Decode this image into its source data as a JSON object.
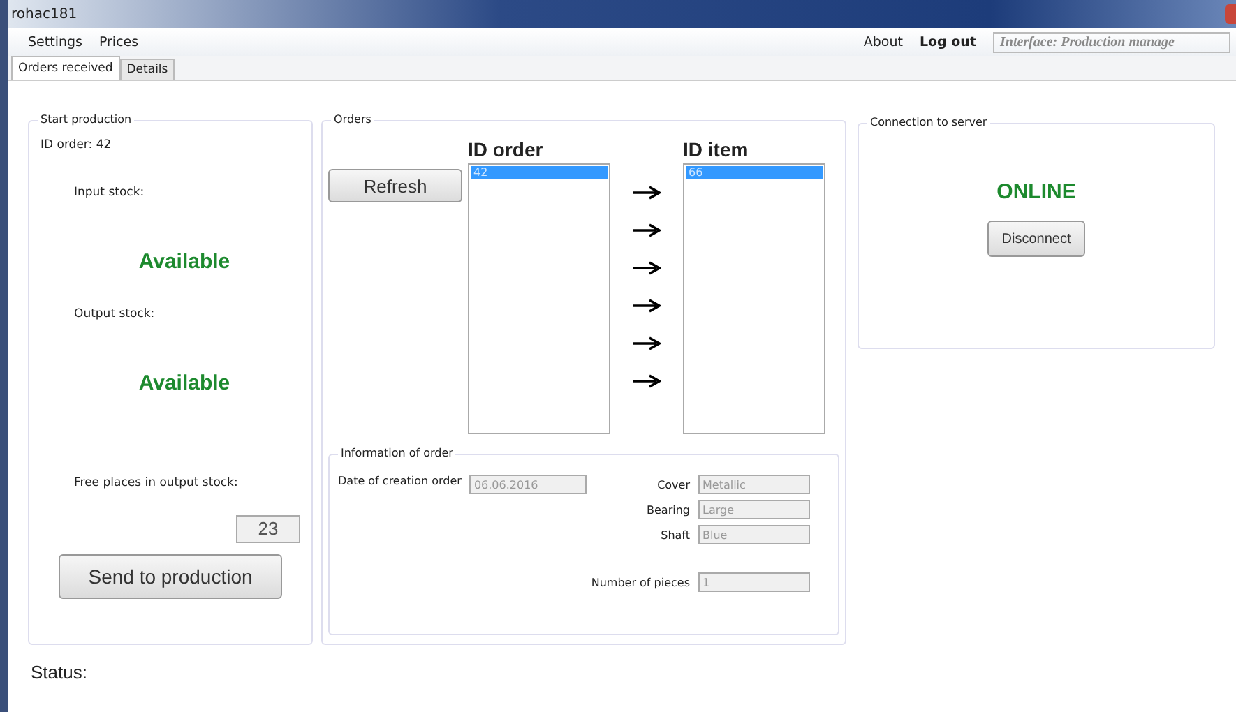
{
  "window": {
    "title": "rohac181"
  },
  "menu": {
    "left": [
      "Settings",
      "Prices"
    ],
    "right": [
      {
        "label": "About",
        "bold": false
      },
      {
        "label": "Log out",
        "bold": true
      }
    ],
    "interface_field": "Interface: Production manage"
  },
  "tabs": [
    {
      "label": "Orders received",
      "selected": true
    },
    {
      "label": "Details",
      "selected": false
    }
  ],
  "start_production": {
    "title": "Start production",
    "id_order": "ID order: 42",
    "input_label": "Input stock:",
    "input_status": "Available",
    "output_label": "Output stock:",
    "output_status": "Available",
    "free_label": "Free places in output stock:",
    "free_value": "23",
    "button": "Send to production"
  },
  "orders": {
    "title": "Orders",
    "refresh": "Refresh",
    "order_heading": "ID order",
    "item_heading": "ID item",
    "order_list": [
      {
        "text": "42",
        "selected": true
      }
    ],
    "item_list": [
      {
        "text": "66",
        "selected": true
      }
    ],
    "info": {
      "title": "Information of order",
      "date_label": "Date of creation order",
      "date_value": "06.06.2016",
      "fields": [
        {
          "label": "Cover",
          "value": "Metallic"
        },
        {
          "label": "Bearing",
          "value": "Large"
        },
        {
          "label": "Shaft",
          "value": "Blue"
        }
      ],
      "pieces_label": "Number of pieces",
      "pieces_value": "1"
    }
  },
  "connection": {
    "title": "Connection to server",
    "status": "ONLINE",
    "button": "Disconnect"
  },
  "status_bar": {
    "label": "Status:"
  }
}
